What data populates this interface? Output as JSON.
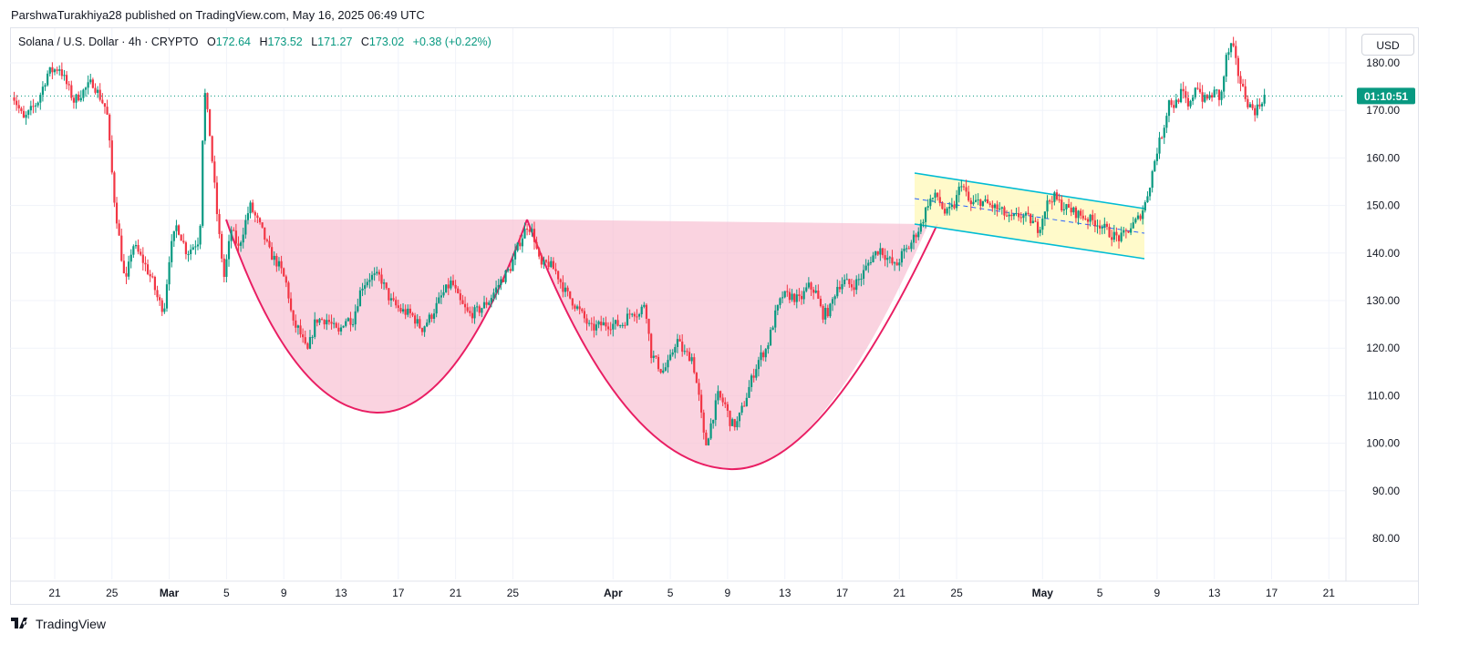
{
  "header": {
    "published_line": "ParshwaTurakhiya28 published on TradingView.com, May 16, 2025 06:49 UTC"
  },
  "legend": {
    "symbol": "Solana / U.S. Dollar · 4h · CRYPTO",
    "open_label": "O",
    "open": "172.64",
    "high_label": "H",
    "high": "173.52",
    "low_label": "L",
    "low": "171.27",
    "close_label": "C",
    "close": "173.02",
    "change": "+0.38 (+0.22%)"
  },
  "currency_button": "USD",
  "price_tag": "01:10:51",
  "footer": {
    "brand": "TradingView",
    "logo_icon": "tradingview-logo-icon"
  },
  "colors": {
    "up": "#089981",
    "down": "#f23645",
    "pattern_fill": "#f8bbd0",
    "pattern_line": "#e91e63",
    "channel_line": "#00bcd4",
    "channel_fill": "#fff9c4",
    "price_line": "#089981",
    "grid": "#f0f3fa"
  },
  "chart_data": {
    "type": "candlestick",
    "symbol": "Solana / U.S. Dollar",
    "timeframe": "4h",
    "ylim": [
      72,
      186
    ],
    "y_ticks": [
      "80.00",
      "90.00",
      "100.00",
      "110.00",
      "120.00",
      "130.00",
      "140.00",
      "150.00",
      "160.00",
      "170.00",
      "180.00"
    ],
    "y_tick_values": [
      80,
      90,
      100,
      110,
      120,
      130,
      140,
      150,
      160,
      170,
      180
    ],
    "x_ticks": [
      {
        "label": "21",
        "day": 0
      },
      {
        "label": "25",
        "day": 4
      },
      {
        "label": "Mar",
        "day": 8
      },
      {
        "label": "5",
        "day": 12
      },
      {
        "label": "9",
        "day": 16
      },
      {
        "label": "13",
        "day": 20
      },
      {
        "label": "17",
        "day": 24
      },
      {
        "label": "21",
        "day": 28
      },
      {
        "label": "25",
        "day": 32
      },
      {
        "label": "Apr",
        "day": 39
      },
      {
        "label": "5",
        "day": 43
      },
      {
        "label": "9",
        "day": 47
      },
      {
        "label": "13",
        "day": 51
      },
      {
        "label": "17",
        "day": 55
      },
      {
        "label": "21",
        "day": 59
      },
      {
        "label": "25",
        "day": 63
      },
      {
        "label": "May",
        "day": 69
      },
      {
        "label": "5",
        "day": 73
      },
      {
        "label": "9",
        "day": 77
      },
      {
        "label": "13",
        "day": 81
      },
      {
        "label": "17",
        "day": 85
      },
      {
        "label": "21",
        "day": 89
      }
    ],
    "last_price": 173.02,
    "price_path": [
      [
        -3.0,
        175
      ],
      [
        -2.0,
        168
      ],
      [
        -1.0,
        172
      ],
      [
        -0.3,
        178
      ],
      [
        0.5,
        179
      ],
      [
        1.5,
        172
      ],
      [
        2.8,
        176
      ],
      [
        3.8,
        170
      ],
      [
        4.3,
        152
      ],
      [
        4.8,
        140
      ],
      [
        5.1,
        133
      ],
      [
        5.6,
        142
      ],
      [
        6.4,
        138
      ],
      [
        7.0,
        134
      ],
      [
        7.4,
        130
      ],
      [
        7.8,
        128
      ],
      [
        8.2,
        140
      ],
      [
        8.7,
        146
      ],
      [
        9.4,
        140
      ],
      [
        10.3,
        143
      ],
      [
        10.6,
        175
      ],
      [
        11.0,
        165
      ],
      [
        11.6,
        145
      ],
      [
        12.0,
        135
      ],
      [
        12.5,
        145
      ],
      [
        13.0,
        141
      ],
      [
        13.8,
        150
      ],
      [
        14.6,
        145
      ],
      [
        15.2,
        140
      ],
      [
        15.9,
        137
      ],
      [
        16.4,
        133
      ],
      [
        16.8,
        125
      ],
      [
        17.2,
        124
      ],
      [
        17.8,
        119
      ],
      [
        18.4,
        126
      ],
      [
        19.2,
        126
      ],
      [
        20.0,
        123
      ],
      [
        20.4,
        126
      ],
      [
        21.0,
        126
      ],
      [
        21.6,
        133
      ],
      [
        22.2,
        135
      ],
      [
        22.9,
        135
      ],
      [
        23.6,
        130
      ],
      [
        24.3,
        128
      ],
      [
        25.1,
        127
      ],
      [
        25.8,
        124
      ],
      [
        26.5,
        127
      ],
      [
        27.2,
        131
      ],
      [
        27.9,
        134
      ],
      [
        28.4,
        130
      ],
      [
        29.1,
        127
      ],
      [
        29.8,
        128
      ],
      [
        30.5,
        130
      ],
      [
        31.3,
        134
      ],
      [
        32.0,
        137
      ],
      [
        32.6,
        142
      ],
      [
        33.2,
        146
      ],
      [
        33.6,
        144
      ],
      [
        34.1,
        137
      ],
      [
        34.6,
        138
      ],
      [
        35.2,
        136
      ],
      [
        35.8,
        132
      ],
      [
        36.3,
        130
      ],
      [
        37.0,
        127
      ],
      [
        37.6,
        124
      ],
      [
        38.4,
        125
      ],
      [
        39.1,
        125
      ],
      [
        39.8,
        125
      ],
      [
        40.5,
        128
      ],
      [
        41.0,
        127
      ],
      [
        41.4,
        130
      ],
      [
        41.8,
        119
      ],
      [
        42.2,
        117
      ],
      [
        42.6,
        115
      ],
      [
        43.1,
        117
      ],
      [
        43.6,
        122
      ],
      [
        44.1,
        119
      ],
      [
        44.7,
        118
      ],
      [
        45.2,
        109
      ],
      [
        45.6,
        99
      ],
      [
        46.0,
        104
      ],
      [
        46.5,
        110
      ],
      [
        47.0,
        108
      ],
      [
        47.4,
        104
      ],
      [
        47.8,
        104
      ],
      [
        48.4,
        109
      ],
      [
        48.9,
        114
      ],
      [
        49.4,
        118
      ],
      [
        49.9,
        120
      ],
      [
        50.5,
        127
      ],
      [
        51.0,
        131
      ],
      [
        51.6,
        131
      ],
      [
        52.2,
        130
      ],
      [
        52.8,
        133
      ],
      [
        53.3,
        132
      ],
      [
        53.8,
        127
      ],
      [
        54.3,
        128
      ],
      [
        54.8,
        133
      ],
      [
        55.3,
        134
      ],
      [
        55.9,
        133
      ],
      [
        56.5,
        135
      ],
      [
        57.2,
        139
      ],
      [
        57.8,
        141
      ],
      [
        58.3,
        139
      ],
      [
        58.9,
        137
      ],
      [
        59.4,
        140
      ],
      [
        59.8,
        141
      ],
      [
        60.3,
        144
      ],
      [
        60.7,
        146
      ],
      [
        61.2,
        151
      ],
      [
        61.8,
        152
      ],
      [
        62.4,
        148
      ],
      [
        63.0,
        150
      ],
      [
        63.5,
        155
      ],
      [
        64.1,
        150
      ],
      [
        64.8,
        151
      ],
      [
        65.5,
        150
      ],
      [
        66.2,
        149
      ],
      [
        66.9,
        147
      ],
      [
        67.6,
        148
      ],
      [
        68.3,
        147
      ],
      [
        68.9,
        145
      ],
      [
        69.4,
        150
      ],
      [
        69.9,
        152
      ],
      [
        70.5,
        150
      ],
      [
        71.1,
        149
      ],
      [
        71.8,
        148
      ],
      [
        72.5,
        147
      ],
      [
        73.2,
        146
      ],
      [
        73.9,
        144
      ],
      [
        74.6,
        143
      ],
      [
        75.2,
        145
      ],
      [
        75.8,
        147
      ],
      [
        76.3,
        150
      ],
      [
        76.7,
        155
      ],
      [
        77.1,
        161
      ],
      [
        77.6,
        166
      ],
      [
        78.0,
        172
      ],
      [
        78.4,
        171
      ],
      [
        78.9,
        174
      ],
      [
        79.4,
        170
      ],
      [
        79.9,
        176
      ],
      [
        80.4,
        172
      ],
      [
        80.9,
        173
      ],
      [
        81.3,
        174
      ],
      [
        81.6,
        172
      ],
      [
        82.0,
        181
      ],
      [
        82.4,
        184
      ],
      [
        82.8,
        178
      ],
      [
        83.2,
        174
      ],
      [
        83.6,
        171
      ],
      [
        84.0,
        170
      ],
      [
        84.3,
        171
      ],
      [
        84.6,
        173
      ]
    ],
    "annotations": {
      "cup_and_handle": "pink double-bottom / cup pattern between ~Mar 5 and Apr 23 with neckline near 147",
      "descending_channel": "falling channel (yellow) from ~Apr 22 to May 8, breakout above",
      "current_price_line": 173.02
    }
  }
}
